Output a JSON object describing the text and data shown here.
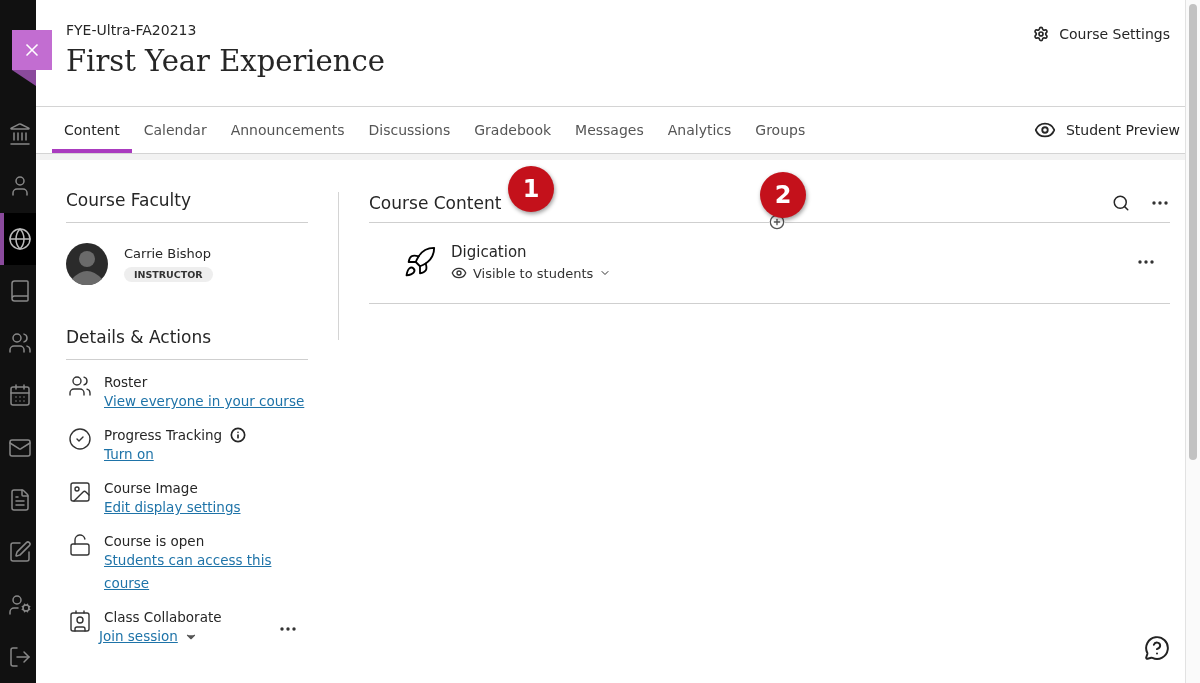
{
  "nav": {
    "items": [
      {
        "kind": "institution",
        "selected": false
      },
      {
        "kind": "profile",
        "selected": false
      },
      {
        "kind": "courses",
        "selected": true
      },
      {
        "kind": "organizations",
        "selected": false
      },
      {
        "kind": "groups",
        "selected": false
      },
      {
        "kind": "calendar",
        "selected": false
      },
      {
        "kind": "messages",
        "selected": false
      },
      {
        "kind": "grades",
        "selected": false
      },
      {
        "kind": "tools",
        "selected": false
      },
      {
        "kind": "admin",
        "selected": false
      },
      {
        "kind": "signout",
        "selected": false
      }
    ]
  },
  "header": {
    "course_code": "FYE-Ultra-FA20213",
    "title": "First Year Experience",
    "settings": "Course Settings"
  },
  "tabs": [
    {
      "label": "Content",
      "selected": true
    },
    {
      "label": "Calendar",
      "selected": false
    },
    {
      "label": "Announcements",
      "selected": false
    },
    {
      "label": "Discussions",
      "selected": false
    },
    {
      "label": "Gradebook",
      "selected": false
    },
    {
      "label": "Messages",
      "selected": false
    },
    {
      "label": "Analytics",
      "selected": false
    },
    {
      "label": "Groups",
      "selected": false
    }
  ],
  "student_preview": "Student Preview",
  "faculty": {
    "heading": "Course Faculty",
    "name": "Carrie Bishop",
    "role": "INSTRUCTOR"
  },
  "details": {
    "heading": "Details & Actions",
    "items": [
      {
        "kind": "roster",
        "title": "Roster",
        "link": "View everyone in your course"
      },
      {
        "kind": "progress",
        "title": "Progress Tracking",
        "link": "Turn on"
      },
      {
        "kind": "image",
        "title": "Course Image",
        "link": "Edit display settings"
      },
      {
        "kind": "open",
        "title": "Course is open",
        "link": "Students can access this course"
      },
      {
        "kind": "collaborate",
        "title": "Class Collaborate",
        "link": "Join session"
      }
    ]
  },
  "content": {
    "heading": "Course Content",
    "items": [
      {
        "title": "Digication",
        "visibility": "Visible to students"
      }
    ]
  },
  "callouts": [
    "1",
    "2"
  ]
}
